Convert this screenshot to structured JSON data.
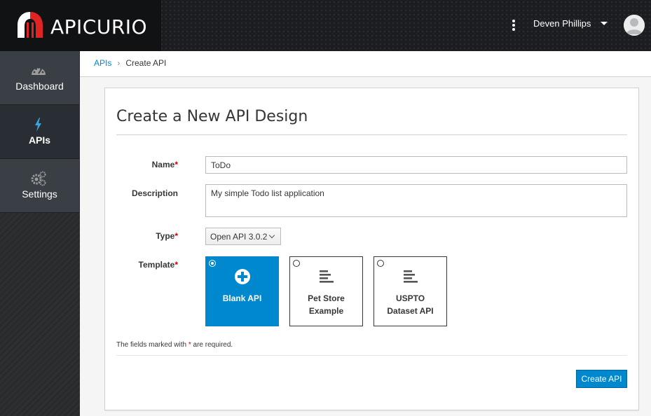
{
  "brand": {
    "name": "APICURIO"
  },
  "header": {
    "user_name": "Deven Phillips"
  },
  "sidebar": {
    "items": [
      {
        "label": "Dashboard",
        "icon": "dashboard-icon"
      },
      {
        "label": "APIs",
        "icon": "bolt-icon",
        "active": true
      },
      {
        "label": "Settings",
        "icon": "gears-icon"
      }
    ]
  },
  "breadcrumb": {
    "parent": "APIs",
    "current": "Create API"
  },
  "form": {
    "title": "Create a New API Design",
    "name_label": "Name",
    "name_value": "ToDo",
    "description_label": "Description",
    "description_value": "My simple Todo list application",
    "type_label": "Type",
    "type_value": "Open API 3.0.2",
    "template_label": "Template",
    "required_marker": "*",
    "templates": [
      {
        "label": "Blank API",
        "icon": "plus-circle-icon",
        "selected": true
      },
      {
        "label": "Pet Store Example",
        "icon": "align-left-icon",
        "selected": false
      },
      {
        "label": "USPTO Dataset API",
        "icon": "align-left-icon",
        "selected": false
      }
    ],
    "note_before": "The fields marked with ",
    "note_after": " are required.",
    "submit_label": "Create API"
  },
  "colors": {
    "accent": "#0088ce",
    "required": "#cc0000",
    "topbar": "#1b1d20"
  }
}
